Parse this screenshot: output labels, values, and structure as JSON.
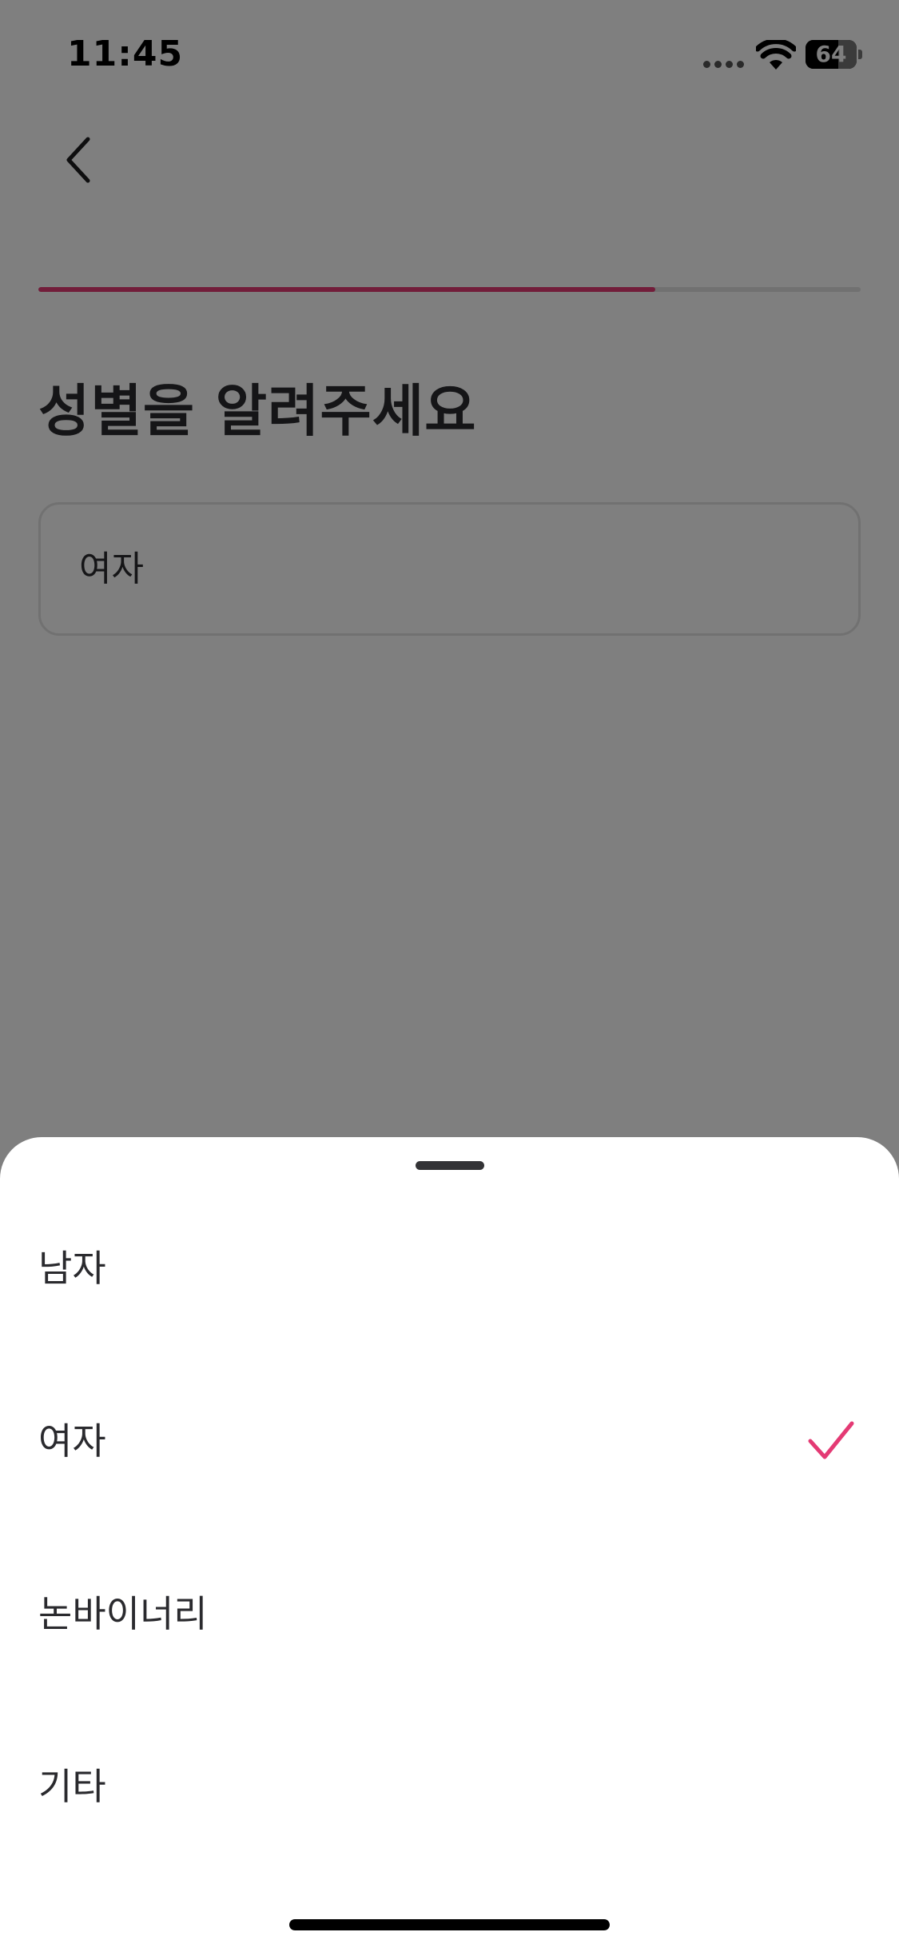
{
  "status_bar": {
    "time": "11:45",
    "battery_level": "64"
  },
  "progress": {
    "fraction": 0.75,
    "color": "#e43a74"
  },
  "header": {
    "back_icon": "chevron-left-icon"
  },
  "main": {
    "title": "성별을 알려주세요",
    "selected_value": "여자"
  },
  "sheet": {
    "options": [
      {
        "label": "남자",
        "selected": false
      },
      {
        "label": "여자",
        "selected": true
      },
      {
        "label": "논바이너리",
        "selected": false
      },
      {
        "label": "기타",
        "selected": false
      }
    ],
    "check_icon": "checkmark-icon",
    "accent_color": "#e43a74"
  }
}
